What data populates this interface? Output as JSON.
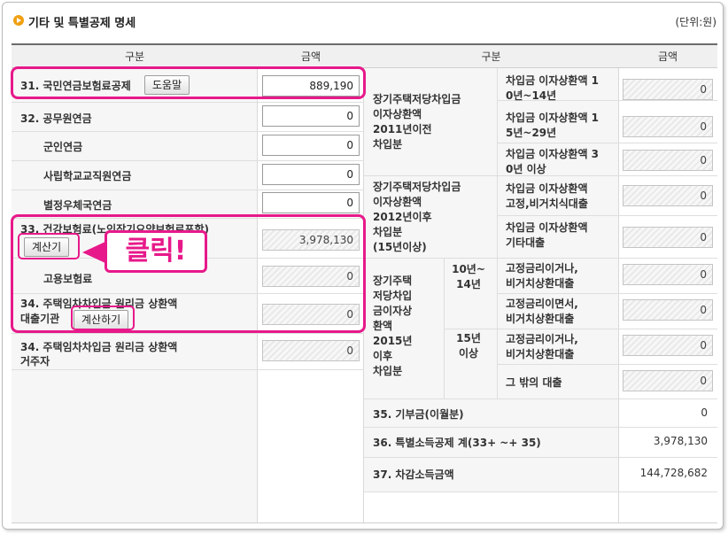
{
  "header": {
    "title": "기타 및 특별공제 명세",
    "unit": "(단위:원)"
  },
  "columns": {
    "left_label": "구분",
    "left_amount": "금액",
    "right_label": "구분",
    "right_amount": "금액"
  },
  "left": {
    "national_pension": {
      "label": "31. 국민연금보험료공제",
      "help_button": "도움말",
      "value": "889,190"
    },
    "public_pension": {
      "label": "32. 공무원연금",
      "value": "0"
    },
    "military_pension": {
      "label": "군인연금",
      "value": "0"
    },
    "private_school_pension": {
      "label": "사립학교교직원연금",
      "value": "0"
    },
    "postal_pension": {
      "label": "별정우체국연금",
      "value": "0"
    },
    "health_insurance": {
      "label": "33. 건강보험료(노인장기요양보험료포함)",
      "calc_button": "계산기",
      "value": "3,978,130"
    },
    "employment_insurance": {
      "label": "고용보험료",
      "value": "0"
    },
    "housing_loan_lender": {
      "label_line1": "34. 주택임차차입금 원리금 상환액",
      "label_line2": "대출기관",
      "calc_button": "계산하기",
      "value": "0"
    },
    "housing_loan_resident": {
      "label_line1": "34. 주택임차차입금 원리금 상환액",
      "label_line2": "거주자",
      "value": "0"
    }
  },
  "right": {
    "group_2011": {
      "label_lines": [
        "장기주택저당차입금",
        "이자상환액",
        "2011년이전",
        "차입분"
      ]
    },
    "group_2012": {
      "label_lines": [
        "장기주택저당차입금",
        "이자상환액",
        "2012년이후",
        "차입분",
        "(15년이상)"
      ]
    },
    "group_2015": {
      "label_lines": [
        "장기주택",
        "저당차입",
        "금이자상",
        "환액",
        "2015년",
        "이후",
        "차입분"
      ]
    },
    "term_10_14": {
      "label_lines": [
        "10년~",
        "14년"
      ]
    },
    "term_15": {
      "label_lines": [
        "15년",
        "이상"
      ]
    },
    "rows": [
      {
        "label_lines": [
          "차입금 이자상환액 1",
          "0년~14년"
        ],
        "value": "0"
      },
      {
        "label_lines": [
          "차입금 이자상환액 1",
          "5년~29년"
        ],
        "value": "0"
      },
      {
        "label_lines": [
          "차입금 이자상환액 3",
          "0년 이상"
        ],
        "value": "0"
      },
      {
        "label_lines": [
          "차입금 이자상환액",
          "고정,비거치식대출"
        ],
        "value": "0"
      },
      {
        "label_lines": [
          "차입금 이자상환액",
          "기타대출"
        ],
        "value": "0"
      },
      {
        "label_lines": [
          "고정금리이거나,",
          "비거치상환대출"
        ],
        "value": "0"
      },
      {
        "label_lines": [
          "고정금리이면서,",
          "비거치상환대출"
        ],
        "value": "0"
      },
      {
        "label_lines": [
          "고정금리이거나,",
          "비거치상환대출"
        ],
        "value": "0"
      },
      {
        "label_lines": [
          "그 밖의 대출"
        ],
        "value": "0"
      }
    ],
    "donation": {
      "label": "35. 기부금(이월분)",
      "value": "0"
    },
    "special_total": {
      "label": "36. 특별소득공제 계(33+ ~+ 35)",
      "value": "3,978,130"
    },
    "deduction_income": {
      "label": "37. 차감소득금액",
      "value": "144,728,682"
    }
  },
  "annotation": {
    "callout_text": "클릭!",
    "highlight_color": "#e7198a"
  }
}
